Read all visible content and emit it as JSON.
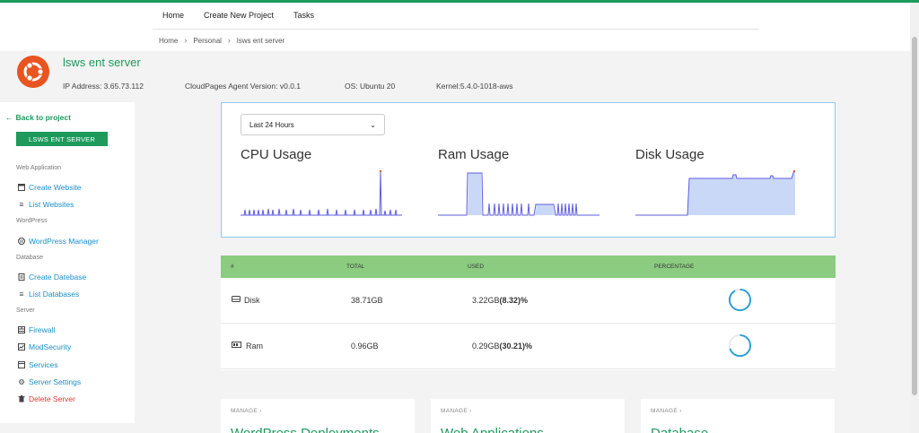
{
  "nav": [
    "Home",
    "Create New Project",
    "Tasks"
  ],
  "breadcrumb": [
    "Home",
    "Personal",
    "lsws ent server"
  ],
  "server": {
    "name": "lsws ent server",
    "ip": "IP Address: 3.65.73.112",
    "agent": "CloudPages Agent Version: v0.0.1",
    "os": "OS: Ubuntu 20",
    "kernel": "Kernel:5.4.0-1018-aws"
  },
  "sidebar": {
    "back": "Back to project",
    "server_button": "LSWS ENT SERVER",
    "sections": {
      "web": "Web Application",
      "wordpress": "WordPress",
      "database": "Database",
      "server": "Server"
    },
    "items": {
      "create_website": "Create Website",
      "list_websites": "List Websites",
      "wp_manager": "WordPress Manager",
      "create_db": "Create Datebase",
      "list_db": "List Databases",
      "firewall": "Firewall",
      "modsecurity": "ModSecurity",
      "services": "Services",
      "server_settings": "Server Settings",
      "delete_server": "Delete Server"
    }
  },
  "usage": {
    "range": "Last 24 Hours",
    "cpu_title": "CPU Usage",
    "ram_title": "Ram Usage",
    "disk_title": "Disk Usage"
  },
  "resources": {
    "headers": [
      "#",
      "TOTAL",
      "USED",
      "PERCENTAGE"
    ],
    "rows": [
      {
        "name": "Disk",
        "total": "38.71GB",
        "used": "3.22GB",
        "pct": "(8.32)%",
        "pct_value": 8.32
      },
      {
        "name": "Ram",
        "total": "0.96GB",
        "used": "0.29GB",
        "pct": "(30.21)%",
        "pct_value": 30.21
      }
    ]
  },
  "manage": [
    {
      "label": "MANAGE",
      "title": "WordPress Deployments"
    },
    {
      "label": "MANAGE",
      "title": "Web Applications"
    },
    {
      "label": "MANAGE",
      "title": "Database"
    }
  ],
  "colors": {
    "brand": "#1d9a5c",
    "link": "#1a8fc9",
    "danger": "#e53935",
    "chart_line": "#5f5ce0",
    "disk_fill": "#c9d8f7"
  }
}
